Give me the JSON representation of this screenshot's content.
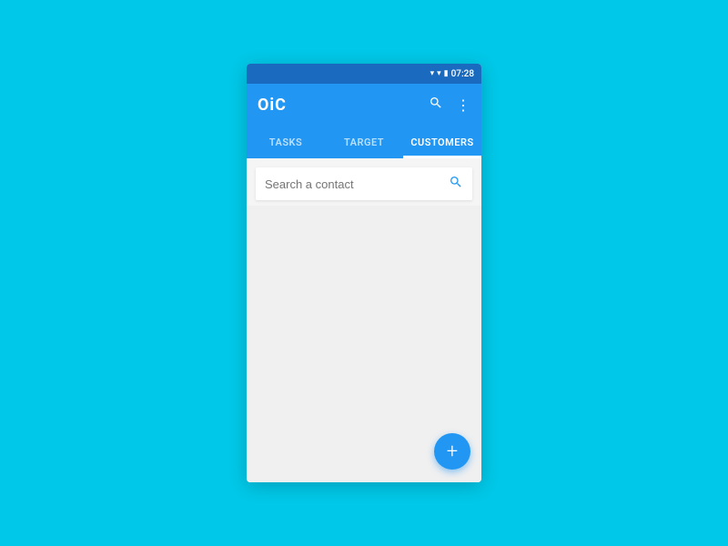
{
  "statusBar": {
    "time": "07:28",
    "wifiIcon": "▾",
    "signalIcon": "▾",
    "batteryIcon": "▮"
  },
  "appBar": {
    "logo": "OiC",
    "searchIcon": "⌕",
    "menuIcon": "⋮"
  },
  "tabs": [
    {
      "id": "tasks",
      "label": "TASKS",
      "active": false
    },
    {
      "id": "target",
      "label": "TARGET",
      "active": false
    },
    {
      "id": "customers",
      "label": "CUSTOMERS",
      "active": true
    }
  ],
  "search": {
    "placeholder": "Search a contact"
  },
  "fab": {
    "label": "+"
  }
}
